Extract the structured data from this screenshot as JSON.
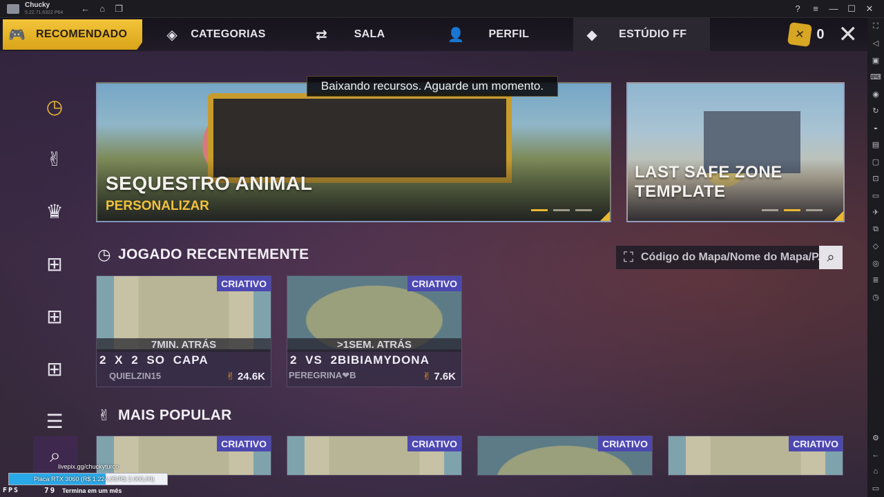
{
  "window": {
    "title": "Chucky",
    "version": "5.22.71.6322  P64",
    "buttons": [
      "?",
      "≡",
      "—",
      "☐",
      "✕"
    ],
    "nav": [
      "←",
      "⌂",
      "❐"
    ]
  },
  "topnav": {
    "items": [
      {
        "label": "RECOMENDADO",
        "icon": "gamepad-icon",
        "glyph": "🎮"
      },
      {
        "label": "CATEGORIAS",
        "icon": "layers-icon",
        "glyph": "◈"
      },
      {
        "label": "SALA",
        "icon": "room-icon",
        "glyph": "⇄"
      },
      {
        "label": "PERFIL",
        "icon": "user-icon",
        "glyph": "👤"
      },
      {
        "label": "ESTÚDIO FF",
        "icon": "studio-icon",
        "glyph": "◆"
      }
    ],
    "coins": "0",
    "close": "✕"
  },
  "toast": "Baixando recursos. Aguarde um momento.",
  "banners": [
    {
      "title": "SEQUESTRO ANIMAL",
      "subtitle": "PERSONALIZAR"
    },
    {
      "title": "LAST SAFE ZONE TEMPLATE"
    }
  ],
  "sections": {
    "recent": "JOGADO RECENTEMENTE",
    "popular": "MAIS POPULAR"
  },
  "search": {
    "placeholder": "Código do Mapa/Nome do Mapa/P..."
  },
  "recent_cards": [
    {
      "tag": "CRIATIVO",
      "ago": "7MIN. ATRÁS",
      "name": "2 X 2 SO CAPA",
      "author": "QUIELZIN15",
      "likes": "24.6K"
    },
    {
      "tag": "CRIATIVO",
      "ago": ">1SEM. ATRÁS",
      "name": "2 VS 2BIBIAMYDONA",
      "author": "PEREGRINA❤B",
      "likes": "7.6K"
    }
  ],
  "popular_cards": [
    {
      "tag": "CRIATIVO"
    },
    {
      "tag": "CRIATIVO"
    },
    {
      "tag": "CRIATIVO"
    },
    {
      "tag": "CRIATIVO"
    }
  ],
  "overlay": {
    "url": "livepix.gg/chuckyturco",
    "goal": "Placa RTX 3060 (R$ 1.224,05/R$ 2.000,00)",
    "goal_progress": 0.612,
    "fps_label": "FPS",
    "fps_value": "79",
    "ends": "Termina em um mês"
  },
  "colors": {
    "accent": "#e9b831",
    "tag": "#4d48b0",
    "bar": "#2aa9e8"
  }
}
